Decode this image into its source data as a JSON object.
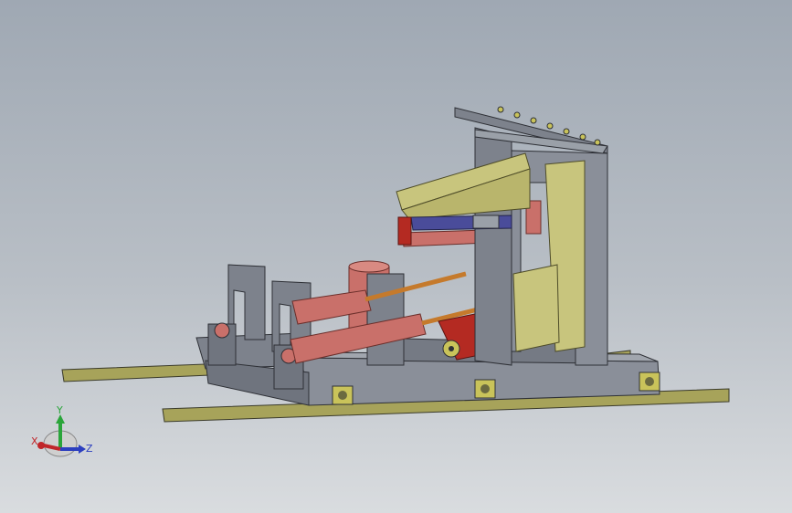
{
  "viewport": {
    "background_top": "#9fa8b3",
    "background_bottom": "#d9dcdf"
  },
  "colors": {
    "frame_gray": "#7d828c",
    "frame_dark": "#5b6069",
    "rail_olive": "#a7a35a",
    "panel_khaki": "#c8c57d",
    "cylinder_pink": "#c9706a",
    "cylinder_dark": "#9e4e4a",
    "rod_orange": "#c57a2c",
    "red_plate": "#b42a22",
    "blue_bar": "#4a4c9a"
  },
  "triad": {
    "x_label": "X",
    "y_label": "Y",
    "z_label": "Z",
    "x_color": "#c0262a",
    "y_color": "#2aa53a",
    "z_color": "#2c3fbf",
    "icon": "coordinate-triad-icon"
  }
}
